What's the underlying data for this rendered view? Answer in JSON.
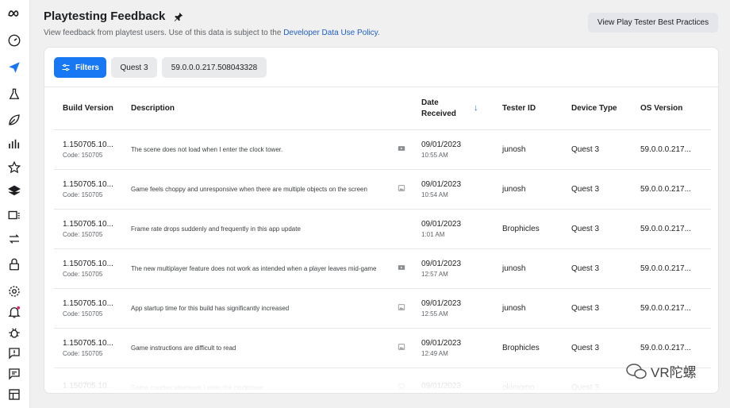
{
  "header": {
    "title": "Playtesting Feedback",
    "subtitle_prefix": "View feedback from playtest users. Use of this data is subject to the ",
    "subtitle_link": "Developer Data Use Policy",
    "subtitle_suffix": ".",
    "best_practices_button": "View Play Tester Best Practices"
  },
  "rail": {
    "icons": [
      "meta-logo-icon",
      "dashboard-gauge-icon",
      "send-plane-icon",
      "flask-icon",
      "leaf-icon",
      "bar-chart-icon",
      "star-icon",
      "layers-icon",
      "media-stack-icon",
      "swap-arrows-icon",
      "lock-icon",
      "settings-gear-icon",
      "bell-icon",
      "bug-icon",
      "feedback-bubble-icon",
      "chat-bubble-icon",
      "layout-icon"
    ]
  },
  "filters": {
    "filters_label": "Filters",
    "chips": [
      "Quest 3",
      "59.0.0.0.217.508043328"
    ]
  },
  "table": {
    "columns": [
      "Build Version",
      "Description",
      "",
      "Date Received",
      "Tester ID",
      "Device Type",
      "OS Version"
    ],
    "rows": [
      {
        "build": "1.150705.10...",
        "code": "Code: 150705",
        "description": "The scene does not load when I enter the clock tower.",
        "media": "video-icon",
        "date": "09/01/2023",
        "time": "10:55 AM",
        "tester": "junosh",
        "device": "Quest 3",
        "os": "59.0.0.0.217..."
      },
      {
        "build": "1.150705.10...",
        "code": "Code: 150705",
        "description": "Game feels choppy and unresponsive when there are multiple objects on the screen",
        "media": "image-icon",
        "date": "09/01/2023",
        "time": "10:54 AM",
        "tester": "junosh",
        "device": "Quest 3",
        "os": "59.0.0.0.217..."
      },
      {
        "build": "1.150705.10...",
        "code": "Code: 150705",
        "description": "Frame rate drops suddenly and frequently in this app update",
        "media": "",
        "date": "09/01/2023",
        "time": "1:01 AM",
        "tester": "Brophicles",
        "device": "Quest 3",
        "os": "59.0.0.0.217..."
      },
      {
        "build": "1.150705.10...",
        "code": "Code: 150705",
        "description": "The new multiplayer feature does not work as intended when a player leaves mid-game",
        "media": "video-icon",
        "date": "09/01/2023",
        "time": "12:57 AM",
        "tester": "junosh",
        "device": "Quest 3",
        "os": "59.0.0.0.217..."
      },
      {
        "build": "1.150705.10...",
        "code": "Code: 150705",
        "description": "App startup time for this build has significantly increased",
        "media": "image-icon",
        "date": "09/01/2023",
        "time": "12:55 AM",
        "tester": "junosh",
        "device": "Quest 3",
        "os": "59.0.0.0.217..."
      },
      {
        "build": "1.150705.10...",
        "code": "Code: 150705",
        "description": "Game instructions are difficult to read",
        "media": "image-icon",
        "date": "09/01/2023",
        "time": "12:49 AM",
        "tester": "Brophicles",
        "device": "Quest 3",
        "os": "59.0.0.0.217..."
      },
      {
        "build": "1.150705.10...",
        "code": "",
        "description": "Game crashes whenever I enter the clocktower",
        "media": "image-icon",
        "date": "09/01/2023",
        "time": "",
        "tester": "okimomo",
        "device": "Quest 3",
        "os": ""
      }
    ]
  },
  "watermark": {
    "text": "VR陀螺"
  },
  "colors": {
    "accent": "#1877f2",
    "link": "#1f5fc6",
    "background": "#f0f0f0"
  }
}
